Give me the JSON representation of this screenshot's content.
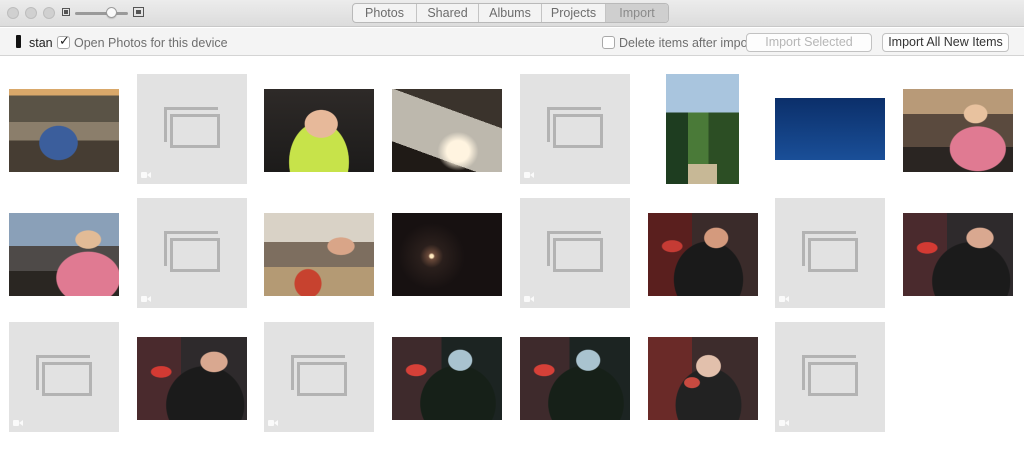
{
  "window": {
    "tabs": [
      {
        "label": "Photos"
      },
      {
        "label": "Shared"
      },
      {
        "label": "Albums"
      },
      {
        "label": "Projects"
      },
      {
        "label": "Import",
        "active": true
      }
    ]
  },
  "devicebar": {
    "device_name": "stan",
    "open_photos_label": "Open Photos for this device",
    "open_photos_checked": true,
    "delete_items_label": "Delete items after import",
    "delete_items_checked": false,
    "import_selected_label": "Import Selected",
    "import_all_label": "Import All New Items"
  },
  "thumbnails": [
    {
      "kind": "photo",
      "subject": "lobby"
    },
    {
      "kind": "video-placeholder"
    },
    {
      "kind": "photo",
      "subject": "boy-green-hoodie"
    },
    {
      "kind": "photo",
      "subject": "device-screen"
    },
    {
      "kind": "video-placeholder"
    },
    {
      "kind": "photo",
      "subject": "forest-trail"
    },
    {
      "kind": "photo",
      "subject": "blue-screen"
    },
    {
      "kind": "photo",
      "subject": "girl-pink-hoodie"
    },
    {
      "kind": "photo",
      "subject": "girl-pink-hoodie-2"
    },
    {
      "kind": "video-placeholder"
    },
    {
      "kind": "photo",
      "subject": "restaurant"
    },
    {
      "kind": "photo",
      "subject": "dark-light"
    },
    {
      "kind": "video-placeholder"
    },
    {
      "kind": "photo",
      "subject": "cinema"
    },
    {
      "kind": "video-placeholder"
    },
    {
      "kind": "photo",
      "subject": "cinema"
    },
    {
      "kind": "video-placeholder"
    },
    {
      "kind": "photo",
      "subject": "cinema"
    },
    {
      "kind": "video-placeholder"
    },
    {
      "kind": "photo",
      "subject": "cinema"
    },
    {
      "kind": "photo",
      "subject": "cinema"
    },
    {
      "kind": "photo",
      "subject": "cinema-blur"
    },
    {
      "kind": "video-placeholder"
    }
  ]
}
